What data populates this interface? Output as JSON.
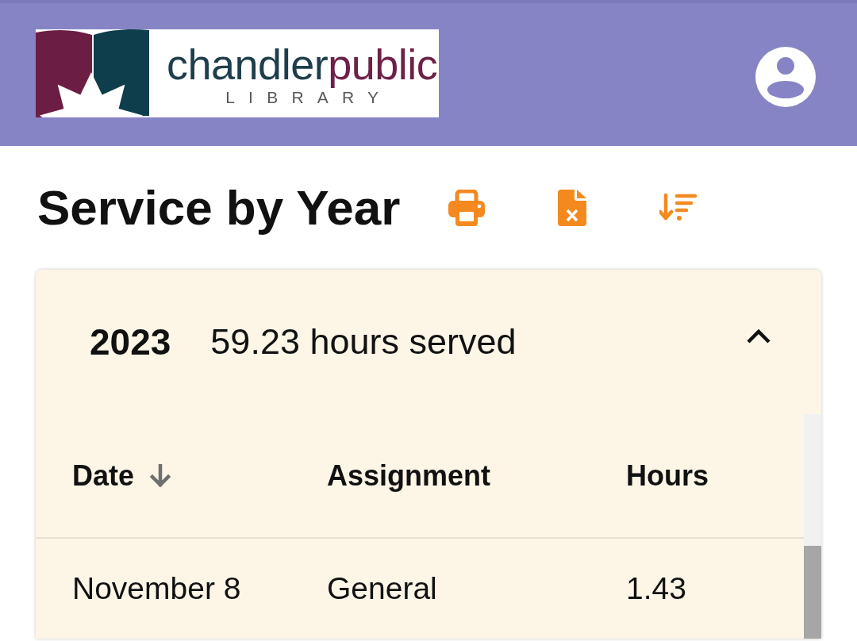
{
  "header": {
    "logo": {
      "wordmark_first": "chandler",
      "wordmark_second": "public",
      "subtitle": "LIBRARY"
    }
  },
  "page": {
    "title": "Service by Year"
  },
  "years": [
    {
      "year": "2023",
      "summary": "59.23 hours served",
      "expanded": true,
      "table": {
        "columns": [
          {
            "label": "Date",
            "sorted": true,
            "descending": true
          },
          {
            "label": "Assignment",
            "sorted": false
          },
          {
            "label": "Hours",
            "sorted": false
          }
        ],
        "rows": [
          {
            "date": "November 8",
            "assignment": "General",
            "hours": "1.43"
          }
        ]
      }
    }
  ]
}
